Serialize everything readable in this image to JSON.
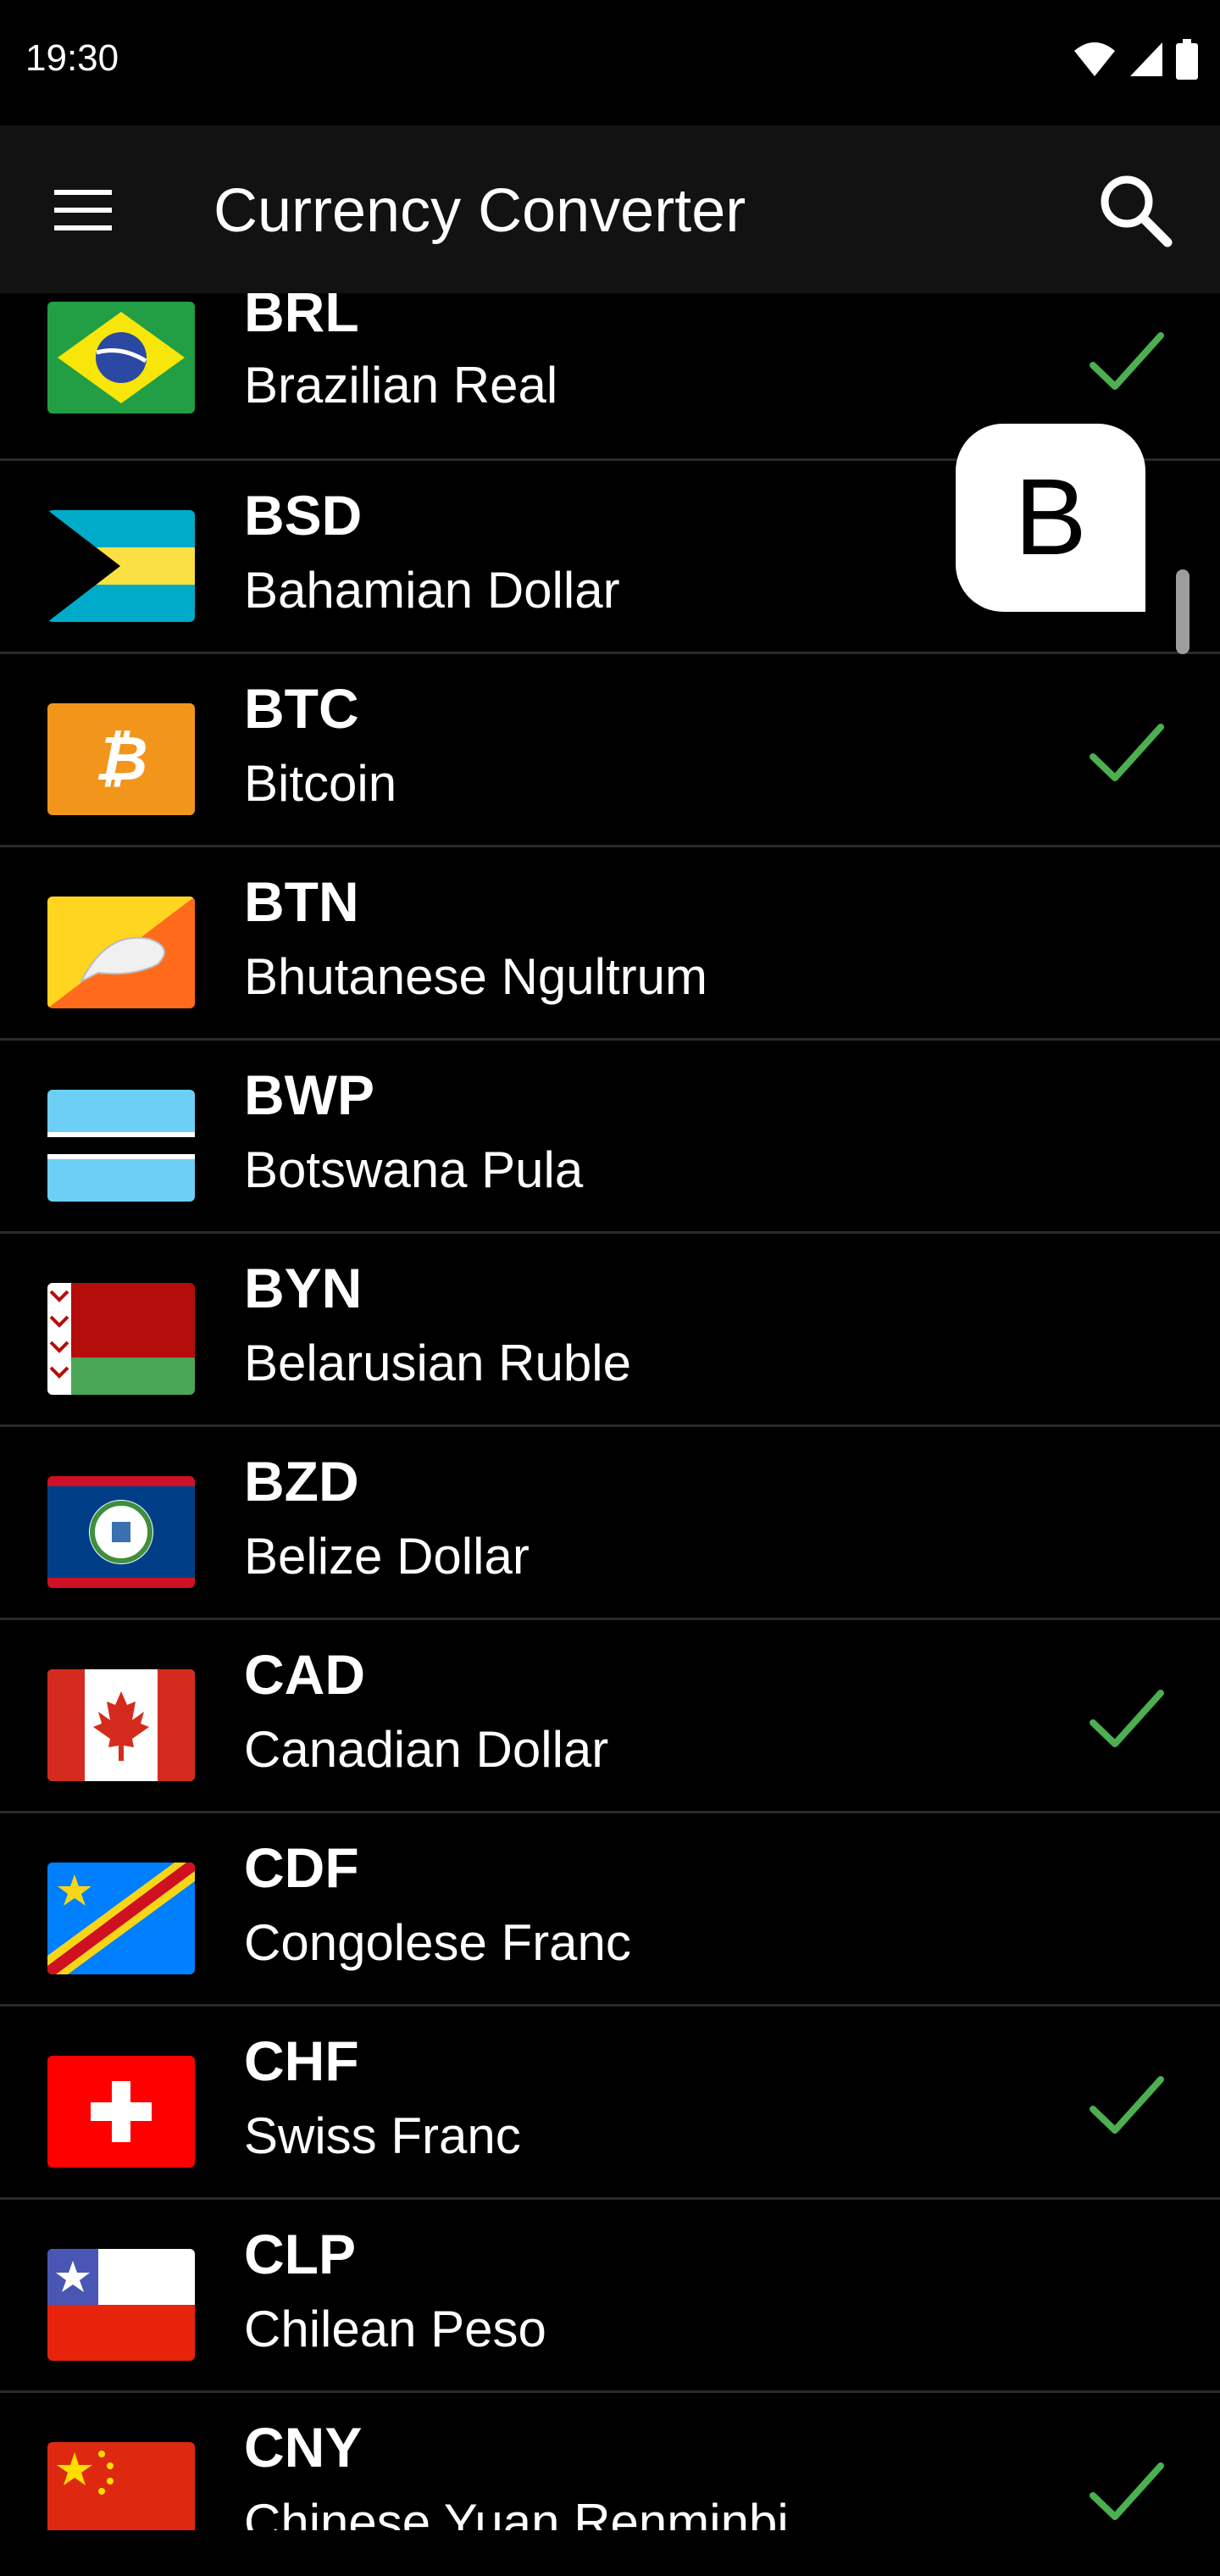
{
  "status_bar": {
    "time": "19:30",
    "icons": [
      "wifi-icon",
      "signal-icon",
      "battery-icon"
    ]
  },
  "app_bar": {
    "title": "Currency Converter",
    "menu_icon": "hamburger-menu-icon",
    "search_icon": "search-icon"
  },
  "fast_scroll": {
    "letter": "B"
  },
  "colors": {
    "check": "#4caf50",
    "app_bar_bg": "#121212",
    "background": "#000000",
    "divider": "#2a2a2a"
  },
  "currencies": [
    {
      "code": "BRL",
      "name": "Brazilian Real",
      "selected": true,
      "flag": "brazil-flag"
    },
    {
      "code": "BSD",
      "name": "Bahamian Dollar",
      "selected": false,
      "flag": "bahamas-flag"
    },
    {
      "code": "BTC",
      "name": "Bitcoin",
      "selected": true,
      "flag": "bitcoin-logo"
    },
    {
      "code": "BTN",
      "name": "Bhutanese Ngultrum",
      "selected": false,
      "flag": "bhutan-flag"
    },
    {
      "code": "BWP",
      "name": "Botswana Pula",
      "selected": false,
      "flag": "botswana-flag"
    },
    {
      "code": "BYN",
      "name": "Belarusian Ruble",
      "selected": false,
      "flag": "belarus-flag"
    },
    {
      "code": "BZD",
      "name": "Belize Dollar",
      "selected": false,
      "flag": "belize-flag"
    },
    {
      "code": "CAD",
      "name": "Canadian Dollar",
      "selected": true,
      "flag": "canada-flag"
    },
    {
      "code": "CDF",
      "name": "Congolese Franc",
      "selected": false,
      "flag": "dr-congo-flag"
    },
    {
      "code": "CHF",
      "name": "Swiss Franc",
      "selected": true,
      "flag": "switzerland-flag"
    },
    {
      "code": "CLP",
      "name": "Chilean Peso",
      "selected": false,
      "flag": "chile-flag"
    },
    {
      "code": "CNY",
      "name": "Chinese Yuan Renminbi",
      "selected": true,
      "flag": "china-flag"
    }
  ]
}
